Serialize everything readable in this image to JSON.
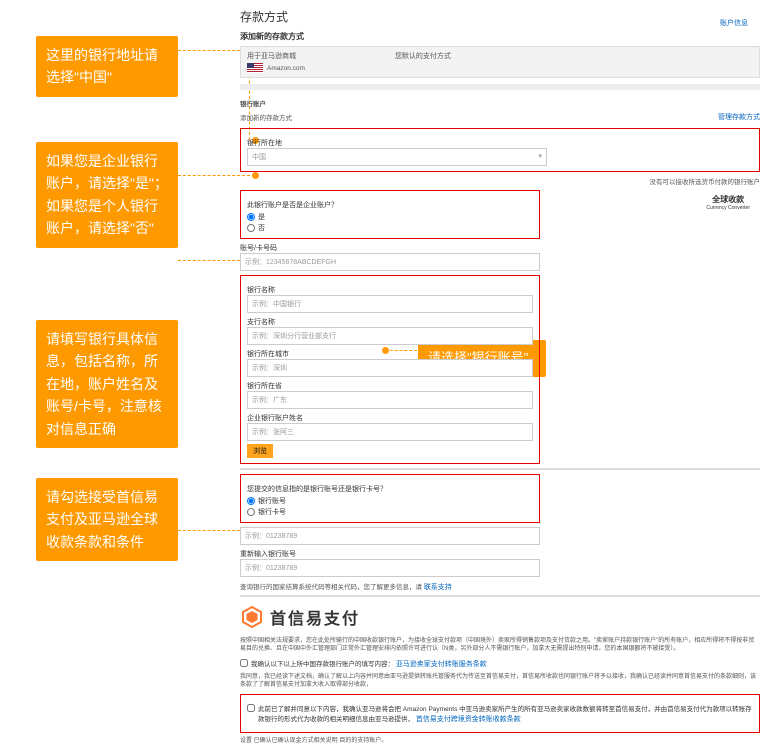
{
  "callouts": {
    "c1": "这里的银行地址请选择\"中国\"",
    "c2": "如果您是企业银行账户，请选择\"是\"；如果您是个人银行账户，请选择\"否\"",
    "c3": "请填写银行具体信息，包括名称，所在地，账户姓名及账号/卡号，注意核对信息正确",
    "c4": "请勾选接受首信易支付及亚马逊全球收款条款和条件",
    "c5": "请选择\"银行账号\""
  },
  "page": {
    "title": "存款方式",
    "topLink": "账户信息",
    "addTitle": "添加新的存款方式",
    "storeLabel": "用于亚马逊商城",
    "routeLabel": "您默认的支付方式",
    "storeValue": "Amazon.com"
  },
  "bank": {
    "sectionTitle": "银行账户",
    "subTitle": "添加新的存款方式",
    "manageLink": "管理存款方式",
    "locLabel": "银行所在地",
    "locValue": "中国",
    "locHint": "没有可以接收所选货币付款的银行账户",
    "enterpriseQ": "此银行账户是否是企业账户？",
    "yes": "是",
    "no": "否",
    "globalPay1": "全球收款",
    "globalPay2": "Currency Converter",
    "acctNoLabel": "账号/卡号码",
    "acctNoPh": "示例：12345678ABCDEFGH",
    "bankNameLabel": "银行名称",
    "bankNamePh": "示例：中国银行",
    "branchLabel": "支行名称",
    "branchPh": "示例：深圳分行营业部支行",
    "cityLabel": "银行所在城市",
    "cityPh": "示例：深圳",
    "provLabel": "银行所在省",
    "provPh": "示例：广东",
    "holderLabel": "企业银行账户姓名",
    "holderPh": "示例：张阿三",
    "btnView": "浏览"
  },
  "acctType": {
    "question": "您提交的信息指的是银行账号还是银行卡号？",
    "opt1": "银行账号",
    "opt2": "银行卡号",
    "ph1": "示例：01238789",
    "reenterLabel": "重新输入银行账号",
    "ph2": "示例：01238789",
    "helpText": "查询银行的国家结算系统代码等相关代码，您了解更多信息，请",
    "helpLink": "联系支持"
  },
  "payeco": {
    "name": "首信易支付"
  },
  "terms": {
    "para1": "按照中国相关法规要求，您在此处所输行的中国收款银行账户，为接收全球支付款项（中国境外）卖家所得销售款项及支付货款之用。\"卖家账户持款银行账户\"的所有账户，相应所得将不得按非贸易目的兑换、且在中国中外汇管理部门正常外汇管理安排内依照许可进行认（N类，另外部分人不需银行账户，加拿大无需提出特别申请，您的本国银额将不被接受）。",
    "chk1": "我确认以下以上所中国存款银行账户的填写内容：",
    "chk1Link": "亚马逊卖家支付转账服务条款",
    "sep": "我同意，我已经读下述文档，确认了解以上内容并同意由亚马逊提供转账托管服务代为传送至首信易支付，首信易所收款也同银行账户将予以接收，我确认已经读并同意首信易支付的条款细则，该条款了了解首信易支付加拿大收入取得部分收款，",
    "chk2a": "此前已了解并同意以下内容，我确认亚马逊将会把 Amazon Payments 中亚马逊卖家所产生的所有亚马逊卖家收款数额将转至首信易支付，并由首信易支付代为款项以转账存款银行的形式代为收款的相关明细信息由亚马逊提供，",
    "chk2Link": "首信易支付跨境资金转账收款条款",
    "footer": "设置   已确认已确认现金方式相关说明 目的的支持账户。"
  }
}
